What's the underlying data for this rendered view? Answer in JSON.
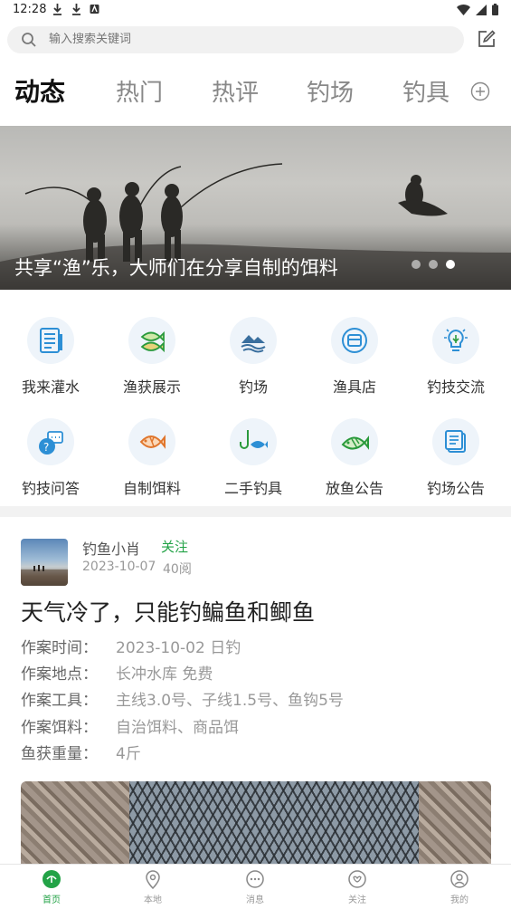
{
  "status_bar": {
    "time": "12:28"
  },
  "search": {
    "placeholder": "输入搜索关键词"
  },
  "tabs": [
    {
      "label": "动态",
      "active": true
    },
    {
      "label": "热门"
    },
    {
      "label": "热评"
    },
    {
      "label": "钓场"
    },
    {
      "label": "钓具"
    }
  ],
  "banner": {
    "caption": "共享“渔”乐，大师们在分享自制的饵料",
    "slide_count": 3,
    "active_slide": 3
  },
  "categories": [
    {
      "label": "我来灌水",
      "icon": "document-list-icon"
    },
    {
      "label": "渔获展示",
      "icon": "fish-pair-icon"
    },
    {
      "label": "钓场",
      "icon": "lake-mountain-icon"
    },
    {
      "label": "渔具店",
      "icon": "shop-icon"
    },
    {
      "label": "钓技交流",
      "icon": "lightbulb-icon"
    },
    {
      "label": "钓技问答",
      "icon": "question-chat-icon"
    },
    {
      "label": "自制饵料",
      "icon": "fish-bait-icon"
    },
    {
      "label": "二手钓具",
      "icon": "hook-fish-icon"
    },
    {
      "label": "放鱼公告",
      "icon": "fish-release-icon"
    },
    {
      "label": "钓场公告",
      "icon": "notice-icon"
    }
  ],
  "post": {
    "author": "钓鱼小肖",
    "follow_label": "关注",
    "date": "2023-10-07",
    "views": "40阅",
    "title": "天气冷了，只能钓鳊鱼和鲫鱼",
    "meta": [
      {
        "key": "作案时间：",
        "value": "2023-10-02 日钓"
      },
      {
        "key": "作案地点：",
        "value": "长冲水库 免费"
      },
      {
        "key": "作案工具：",
        "value": "主线3.0号、子线1.5号、鱼钩5号"
      },
      {
        "key": "作案饵料：",
        "value": "自治饵料、商品饵"
      },
      {
        "key": "鱼获重量：",
        "value": "4斤"
      }
    ]
  },
  "bottom_nav": [
    {
      "label": "首页",
      "icon": "home-icon",
      "active": true
    },
    {
      "label": "本地",
      "icon": "location-pin-icon"
    },
    {
      "label": "消息",
      "icon": "message-icon"
    },
    {
      "label": "关注",
      "icon": "heart-face-icon"
    },
    {
      "label": "我的",
      "icon": "user-icon"
    }
  ],
  "colors": {
    "accent_green": "#23a347",
    "icon_blue": "#2d8fd5",
    "icon_bg": "#eef4fa"
  }
}
